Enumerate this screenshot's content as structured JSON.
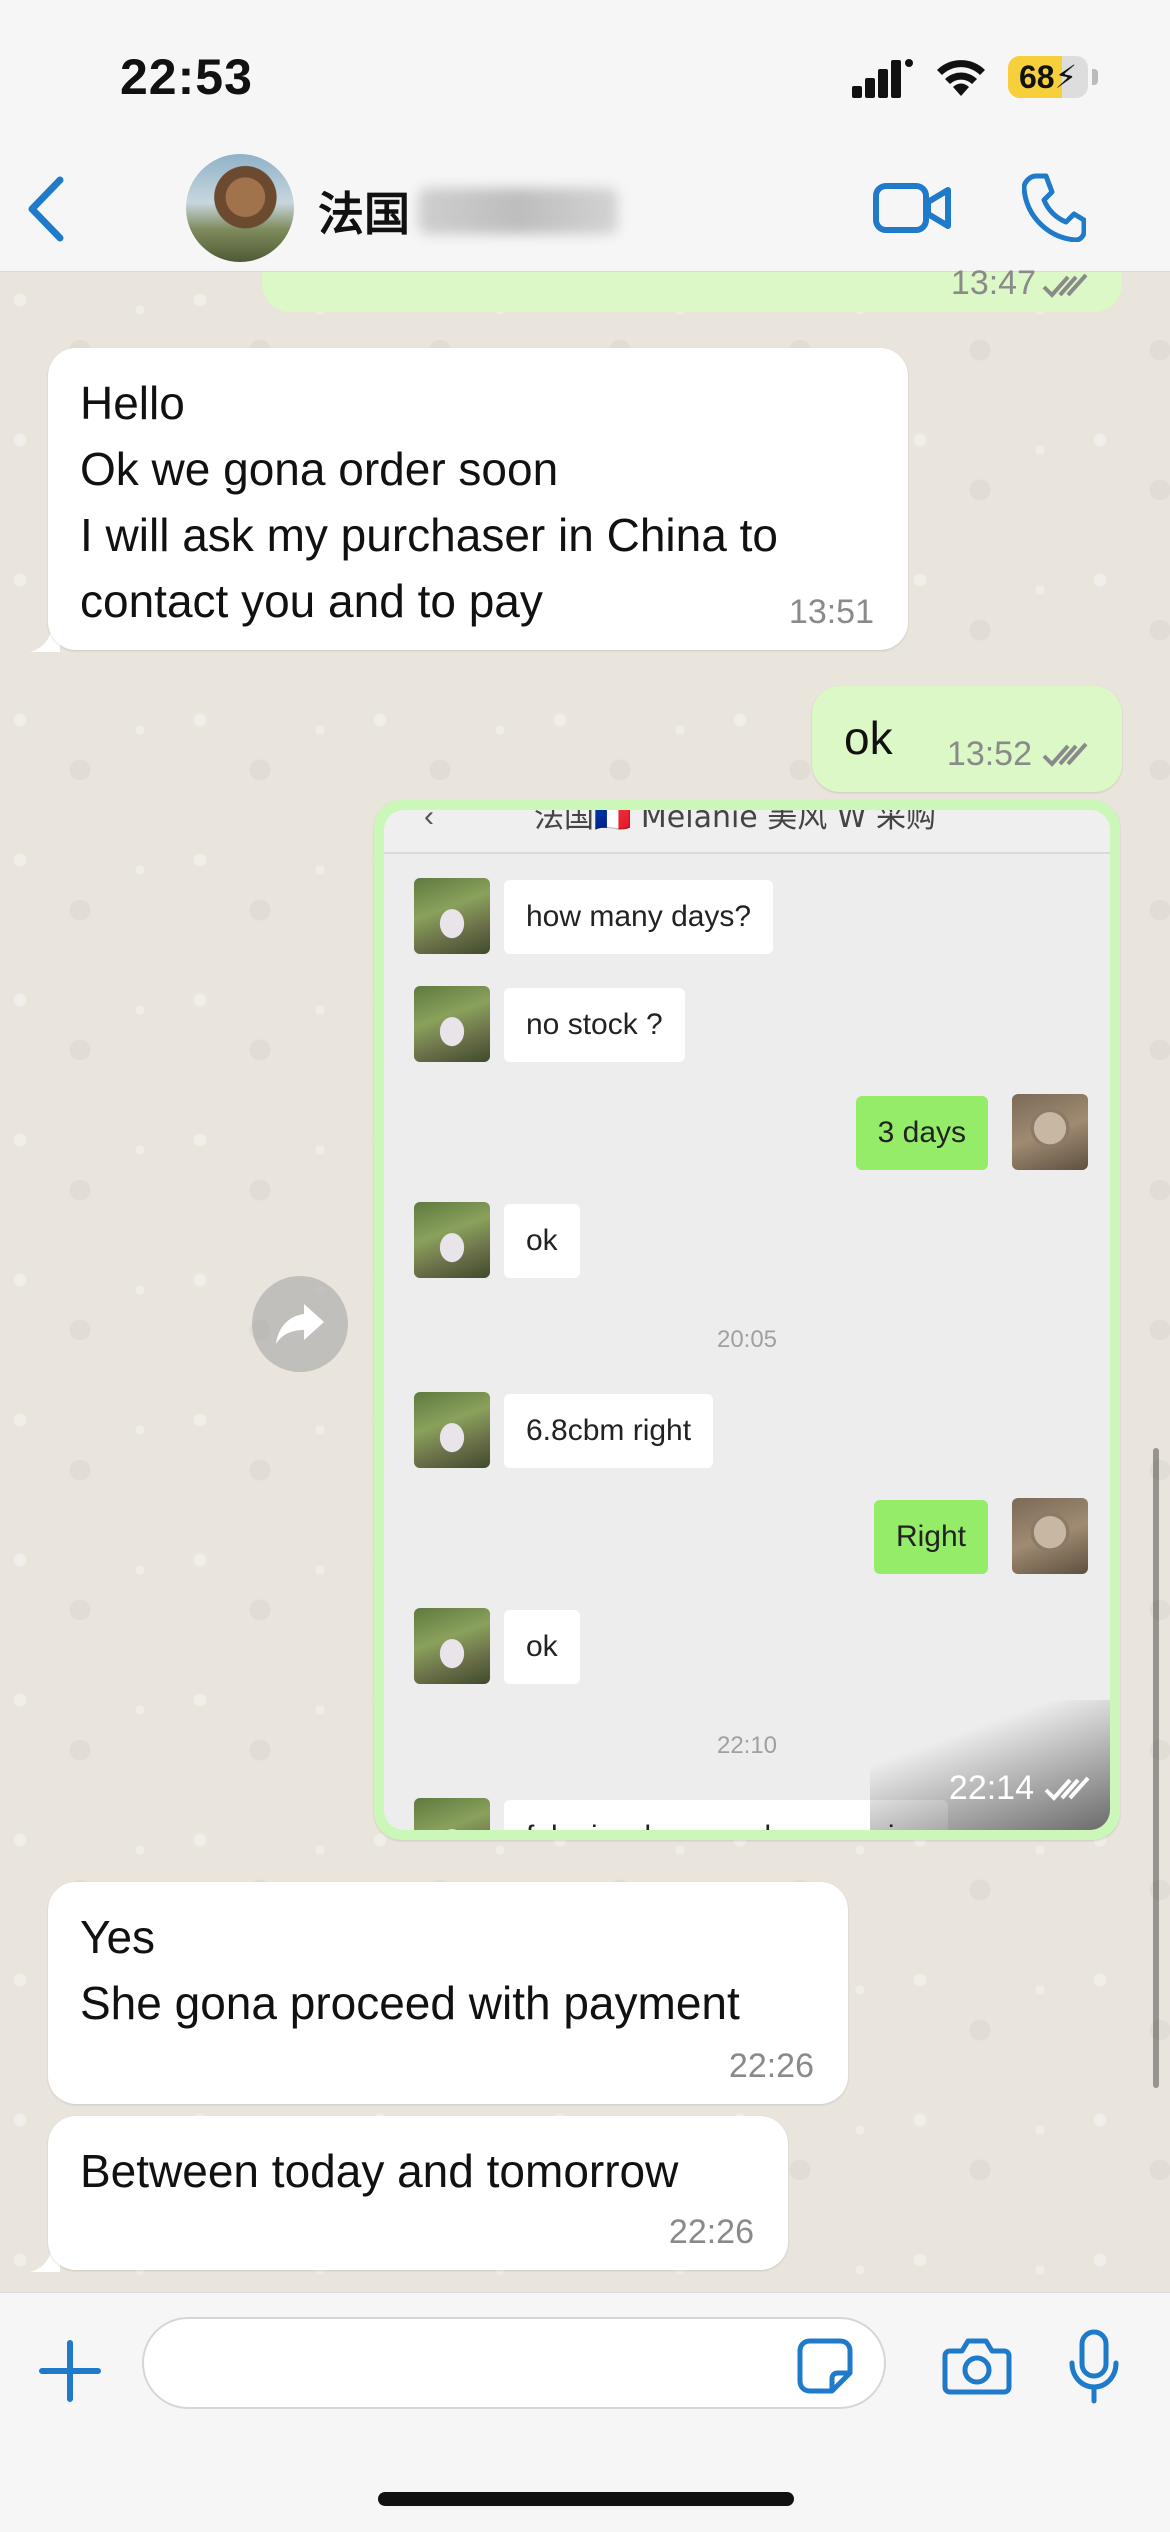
{
  "status_bar": {
    "time": "22:53",
    "battery_percent": "68",
    "battery_level": 0.68
  },
  "header": {
    "contact_name": "法国",
    "accent_color": "#1f7aca"
  },
  "chat": {
    "partial_previous_time": "13:47",
    "messages": [
      {
        "direction": "incoming",
        "text": "Hello\nOk we gona order soon\nI will ask my purchaser in China to\ncontact you and to pay",
        "time": "13:51"
      },
      {
        "direction": "outgoing",
        "text": "ok",
        "time": "13:52",
        "status": "read"
      },
      {
        "direction": "outgoing",
        "type": "image",
        "time": "22:14",
        "status": "read",
        "screenshot": {
          "header_text": "法国🇫🇷 Melanie 美风 W 采购",
          "items": [
            {
              "kind": "msg",
              "side": "left",
              "text": "how many days?"
            },
            {
              "kind": "msg",
              "side": "left",
              "text": "no stock ?"
            },
            {
              "kind": "msg",
              "side": "right",
              "text": "3 days"
            },
            {
              "kind": "msg",
              "side": "left",
              "text": "ok"
            },
            {
              "kind": "time",
              "text": "20:05"
            },
            {
              "kind": "msg",
              "side": "left",
              "text": "6.8cbm right"
            },
            {
              "kind": "msg",
              "side": "right",
              "text": "Right"
            },
            {
              "kind": "msg",
              "side": "left",
              "text": "ok"
            },
            {
              "kind": "time",
              "text": "22:10"
            },
            {
              "kind": "msg",
              "side": "left",
              "text": "fob yiwu how much u can give"
            }
          ]
        }
      },
      {
        "direction": "incoming",
        "text": "Yes\nShe gona proceed with payment",
        "time": "22:26"
      },
      {
        "direction": "incoming",
        "text": "Between today and tomorrow",
        "time": "22:26"
      }
    ]
  },
  "input": {
    "placeholder": ""
  }
}
